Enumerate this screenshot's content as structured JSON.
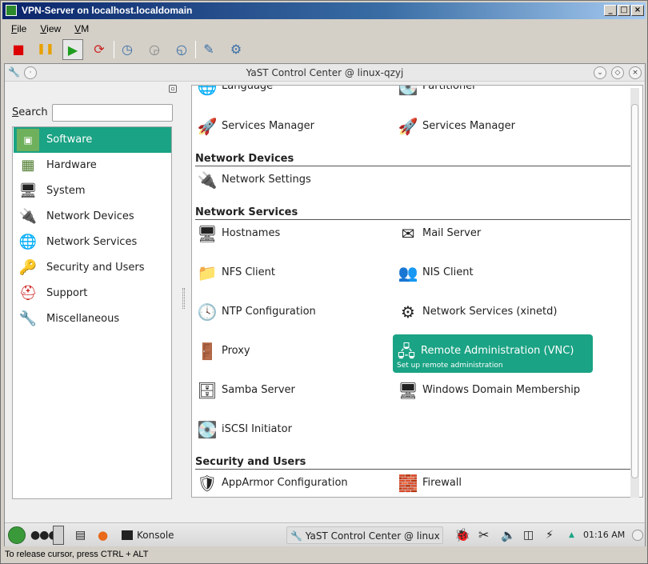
{
  "window": {
    "title": "VPN-Server on localhost.localdomain"
  },
  "menubar": {
    "items": [
      "File",
      "View",
      "VM"
    ]
  },
  "vm_toolbar": {
    "buttons": [
      {
        "name": "stop-icon",
        "glyph": "■",
        "color": "#dd0000"
      },
      {
        "name": "pause-icon",
        "glyph": "❚❚",
        "color": "#e8a000"
      },
      {
        "name": "play-icon",
        "glyph": "▶",
        "color": "#1e9e1e"
      },
      {
        "name": "reset-icon",
        "glyph": "⟳",
        "color": "#cc2222"
      },
      {
        "name": "snapshot-icon",
        "glyph": "◷",
        "color": "#3a6ea5"
      },
      {
        "name": "revert-icon",
        "glyph": "◶",
        "color": "#888888"
      },
      {
        "name": "manage-snapshots-icon",
        "glyph": "◵",
        "color": "#3a6ea5"
      },
      {
        "name": "settings-icon",
        "glyph": "✎",
        "color": "#3a6ea5"
      },
      {
        "name": "tools-icon",
        "glyph": "⚙",
        "color": "#3a6ea5"
      }
    ]
  },
  "yast": {
    "title": "YaST Control Center @ linux-qzyj",
    "search_label": "Search",
    "search_value": "",
    "categories": [
      {
        "label": "Software",
        "icon": "software-icon",
        "glyph": "▣",
        "selected": true
      },
      {
        "label": "Hardware",
        "icon": "hardware-icon",
        "glyph": "▦",
        "selected": false
      },
      {
        "label": "System",
        "icon": "system-icon",
        "glyph": "🖥",
        "selected": false
      },
      {
        "label": "Network Devices",
        "icon": "network-devices-icon",
        "glyph": "🔌",
        "selected": false
      },
      {
        "label": "Network Services",
        "icon": "network-services-icon",
        "glyph": "🌐",
        "selected": false
      },
      {
        "label": "Security and Users",
        "icon": "security-users-icon",
        "glyph": "🔑",
        "selected": false
      },
      {
        "label": "Support",
        "icon": "support-icon",
        "glyph": "⛑",
        "selected": false
      },
      {
        "label": "Miscellaneous",
        "icon": "miscellaneous-icon",
        "glyph": "🔧",
        "selected": false
      }
    ],
    "partial_top": {
      "left": "Language",
      "right": "Partitioner"
    },
    "system_rows": [
      {
        "left": "Services Manager",
        "right": "Services Manager"
      }
    ],
    "sections": {
      "network_devices": "Network Devices",
      "network_services": "Network Services",
      "security_users": "Security and Users"
    },
    "network_devices_modules": [
      "Network Settings"
    ],
    "network_services_modules": [
      {
        "label": "Hostnames",
        "icon": "hostnames-icon",
        "glyph": "🖥"
      },
      {
        "label": "Mail Server",
        "icon": "mail-server-icon",
        "glyph": "✉"
      },
      {
        "label": "NFS Client",
        "icon": "nfs-client-icon",
        "glyph": "📁"
      },
      {
        "label": "NIS Client",
        "icon": "nis-client-icon",
        "glyph": "👥"
      },
      {
        "label": "NTP Configuration",
        "icon": "ntp-icon",
        "glyph": "🕓"
      },
      {
        "label": "Network Services (xinetd)",
        "icon": "xinetd-icon",
        "glyph": "⚙"
      },
      {
        "label": "Proxy",
        "icon": "proxy-icon",
        "glyph": "🚪"
      },
      {
        "label": "Remote Administration (VNC)",
        "icon": "remote-admin-icon",
        "glyph": "🖧",
        "selected": true,
        "description": "Set up remote administration"
      },
      {
        "label": "Samba Server",
        "icon": "samba-server-icon",
        "glyph": "🗄"
      },
      {
        "label": "Windows Domain Membership",
        "icon": "windows-domain-icon",
        "glyph": "🖥"
      },
      {
        "label": "iSCSI Initiator",
        "icon": "iscsi-icon",
        "glyph": "💽"
      }
    ],
    "security_modules": [
      {
        "label": "AppArmor Configuration",
        "icon": "apparmor-icon",
        "glyph": "🛡"
      },
      {
        "label": "Firewall",
        "icon": "firewall-icon",
        "glyph": "🧱"
      }
    ]
  },
  "taskbar": {
    "konsole_label": "Konsole",
    "yast_task_label": "YaST Control Center @ linux",
    "clock": "01:16 AM"
  },
  "statusbar": {
    "text": "To release cursor, press CTRL + ALT"
  },
  "colors": {
    "accent": "#1aa384",
    "titlebar": "#0a246a"
  }
}
